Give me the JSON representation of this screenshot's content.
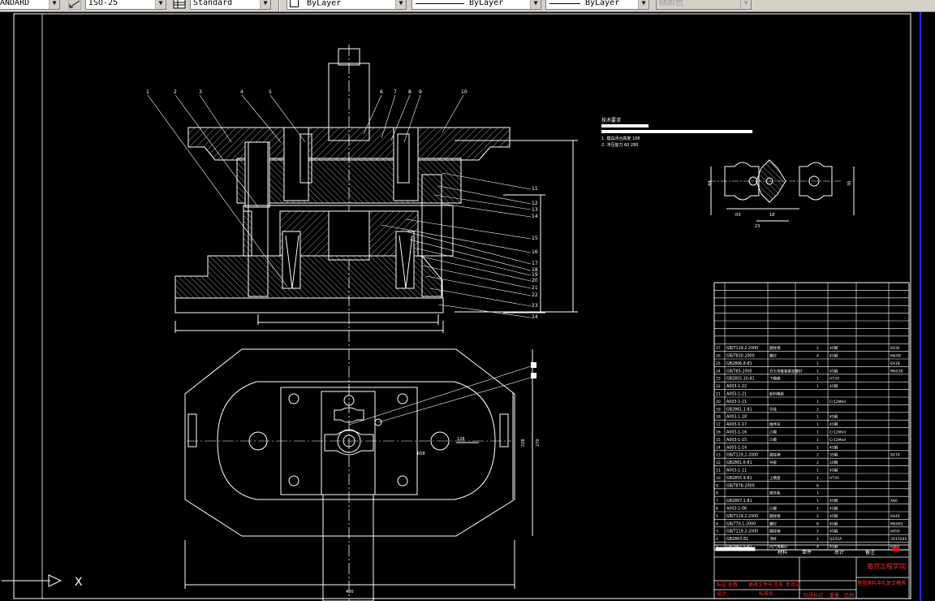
{
  "toolbar": {
    "textstyle_value": "ANDARD",
    "dimstyle_value": "ISO-25",
    "tablestyle_value": "Standard",
    "layer_color_value": "ByLayer",
    "linetype_value": "ByLayer",
    "lineweight_value": "ByLayer",
    "plotstyle_value": "随颜色",
    "icons": [
      "dimstyle-icon",
      "tablestyle-icon",
      "layer-icon"
    ]
  },
  "drawing": {
    "part_labels_top": [
      "1",
      "2",
      "3",
      "4",
      "5",
      "6",
      "7",
      "8",
      "9",
      "10"
    ],
    "part_labels_right": [
      "11",
      "12",
      "13",
      "14",
      "15",
      "16",
      "17",
      "18",
      "19",
      "20",
      "21",
      "22",
      "23",
      "24"
    ],
    "tech_req_title": "技术要求",
    "tech_req_lines": [
      "1. 模具闭合高度 168",
      "2. 冲压能力 60 280"
    ],
    "bom_rows": [
      {
        "no": "27",
        "code": "GB/T119.2-2000",
        "name": "圆柱销",
        "qty": "2",
        "mat": "45钢",
        "note": "6X30"
      },
      {
        "no": "26",
        "code": "GB/T830-2000",
        "name": "螺钉",
        "qty": "4",
        "mat": "45钢",
        "note": "M4X8"
      },
      {
        "no": "25",
        "code": "GB2866.8-81",
        "name": "",
        "qty": "1",
        "mat": "",
        "note": "6X18"
      },
      {
        "no": "24",
        "code": "GB/T85-2000",
        "name": "方头带锥端紧定螺钉",
        "qty": "1",
        "mat": "45钢",
        "note": "M6X30"
      },
      {
        "no": "23",
        "code": "GB2855.10-81",
        "name": "下模座",
        "qty": "1",
        "mat": "HT20",
        "note": ""
      },
      {
        "no": "22",
        "code": "A003-1-22",
        "name": "",
        "qty": "1",
        "mat": "45钢",
        "note": ""
      },
      {
        "no": "21",
        "code": "A003-1-21",
        "name": "卸料橡胶",
        "qty": "",
        "mat": "",
        "note": ""
      },
      {
        "no": "20",
        "code": "A003-1-21",
        "name": "",
        "qty": "1",
        "mat": "Cr12MoV",
        "note": ""
      },
      {
        "no": "19",
        "code": "GB2861.1-81",
        "name": "导柱",
        "qty": "2",
        "mat": "",
        "note": ""
      },
      {
        "no": "18",
        "code": "A003-1-18",
        "name": "",
        "qty": "1",
        "mat": "45钢",
        "note": ""
      },
      {
        "no": "17",
        "code": "A003-1-17",
        "name": "推件块",
        "qty": "1",
        "mat": "45钢",
        "note": ""
      },
      {
        "no": "16",
        "code": "A003-1-16",
        "name": "凸模",
        "qty": "1",
        "mat": "Cr12MoV",
        "note": ""
      },
      {
        "no": "15",
        "code": "A003-1-15",
        "name": "凸模",
        "qty": "1",
        "mat": "Cr12MoV",
        "note": ""
      },
      {
        "no": "14",
        "code": "A003-1-14",
        "name": "",
        "qty": "1",
        "mat": "45钢",
        "note": ""
      },
      {
        "no": "13",
        "code": "GB/T119.2-2000",
        "name": "圆柱销",
        "qty": "2",
        "mat": "35钢",
        "note": "8X70"
      },
      {
        "no": "12",
        "code": "GB2861.6-81",
        "name": "导套",
        "qty": "2",
        "mat": "20钢",
        "note": ""
      },
      {
        "no": "11",
        "code": "A003-1-11",
        "name": "",
        "qty": "1",
        "mat": "45钢",
        "note": ""
      },
      {
        "no": "10",
        "code": "GB2855.9-81",
        "name": "上模座",
        "qty": "1",
        "mat": "HT20",
        "note": ""
      },
      {
        "no": "9",
        "code": "GB/T878-2000",
        "name": "",
        "qty": "6",
        "mat": "",
        "note": ""
      },
      {
        "no": "8",
        "code": "",
        "name": "推件板",
        "qty": "1",
        "mat": "",
        "note": ""
      },
      {
        "no": "7",
        "code": "GB2867.1-81",
        "name": "",
        "qty": "1",
        "mat": "45钢",
        "note": "X60"
      },
      {
        "no": "6",
        "code": "A003-1-06",
        "name": "凸模",
        "qty": "1",
        "mat": "45钢",
        "note": ""
      },
      {
        "no": "5",
        "code": "GB/T119.2-2000",
        "name": "圆柱销",
        "qty": "2",
        "mat": "45钢",
        "note": "6X45"
      },
      {
        "no": "4",
        "code": "GB/T70.1-2000",
        "name": "螺钉",
        "qty": "6",
        "mat": "45钢",
        "note": "M6X65"
      },
      {
        "no": "3",
        "code": "GB/T119.2-2000",
        "name": "圆柱销",
        "qty": "2",
        "mat": "45钢",
        "note": "6X50"
      },
      {
        "no": "2",
        "code": "GB2863-81",
        "name": "顶杆",
        "qty": "1",
        "mat": "Q235A",
        "note": "3X15X45"
      },
      {
        "no": "1",
        "code": "GB2867.5-81",
        "name": "内六角螺钉",
        "qty": "4",
        "mat": "45钢",
        "note": "6X65"
      }
    ],
    "title_block": {
      "school": "南京工程学院",
      "drawing_name": "垫圈落料冲孔复合模具",
      "header_cells": [
        "序号",
        "代号",
        "名称",
        "数量",
        "材料",
        "单件",
        "总计",
        "备注"
      ],
      "row1": [
        "标记",
        "处数",
        "更改文件号",
        "签名",
        "年月日"
      ],
      "row2": [
        "设计",
        "",
        "标准化",
        "",
        "阶段标记",
        "重量",
        "比例"
      ],
      "row3": [
        "审核",
        "",
        "",
        "",
        "共 张",
        "第 张"
      ],
      "row4": [
        "工艺",
        "",
        "批准",
        "",
        "",
        "",
        ""
      ]
    },
    "dimensions": {
      "overall_width": "400",
      "plan_height": "270",
      "inner_width": "228",
      "hole_dist": "128",
      "r_label": "R58",
      "side_view_dim": "23"
    },
    "ucs_axis_label": "X"
  }
}
